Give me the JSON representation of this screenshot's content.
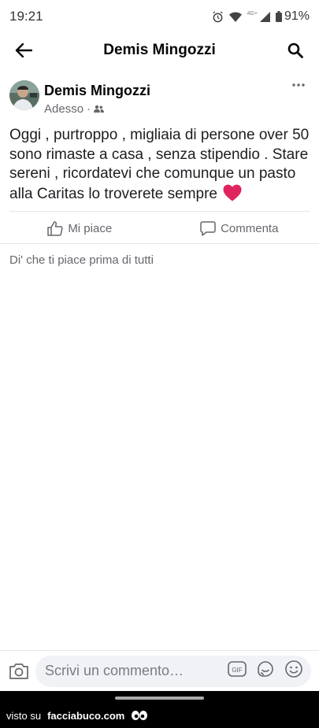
{
  "status_bar": {
    "time": "19:21",
    "network_label": "4G+",
    "battery": "91%"
  },
  "header": {
    "title": "Demis Mingozzi"
  },
  "post": {
    "author": "Demis Mingozzi",
    "timestamp": "Adesso",
    "separator": "·",
    "audience_icon": "friends-icon",
    "text": "Oggi , purtroppo , migliaia di persone over 50 sono rimaste a casa , senza stipendio . Stare sereni , ricordatevi che comunque un pasto alla Caritas lo troverete sempre",
    "emoji": "red-heart"
  },
  "actions": {
    "like_label": "Mi piace",
    "comment_label": "Commenta"
  },
  "first_like_prompt": "Di' che ti piace prima di tutti",
  "composer": {
    "placeholder": "Scrivi un commento…"
  },
  "watermark": {
    "prefix": "visto su",
    "site": "facciabuco.com"
  },
  "colors": {
    "text_primary": "#050505",
    "text_secondary": "#65676b",
    "divider": "#e4e6eb",
    "heart": "#e0245e",
    "composer_bg": "#f0f2f5"
  }
}
